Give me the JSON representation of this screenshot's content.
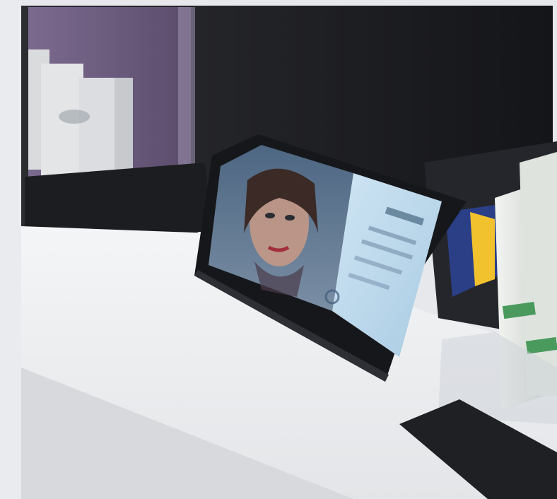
{
  "scene": {
    "description_free": true
  },
  "colors": {
    "counter_top": "#f2f3f4",
    "counter_shadow": "#d9dbde",
    "wall_dark": "#1f2024",
    "wall_mid": "#2b2c31",
    "purple_display": "#6b5a7d",
    "tablet_bezel": "#17181b",
    "tablet_screen_left": "#5e7892",
    "tablet_screen_right": "#b9d6ea",
    "accent_yellow": "#f2c12e",
    "accent_blue": "#2a3f86",
    "bottle_white": "#e8ebe7",
    "bottle_green_label": "#4a9a5d",
    "acrylic_tray": "#c9ced4"
  }
}
